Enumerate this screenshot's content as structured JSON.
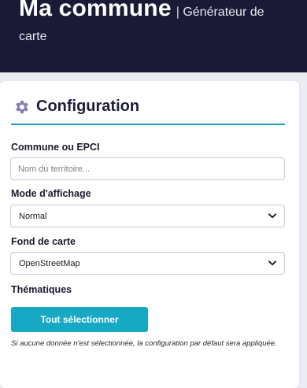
{
  "header": {
    "title": "Ma commune",
    "separator": "|",
    "subtitle_part1": "Générateur de",
    "subtitle_part2": "carte"
  },
  "panel": {
    "title": "Configuration",
    "icon": "gear-icon"
  },
  "fields": {
    "commune": {
      "label": "Commune ou EPCI",
      "value": "",
      "placeholder": "Nom du territoire..."
    },
    "mode": {
      "label": "Mode d'affichage",
      "selected": "Normal"
    },
    "fond": {
      "label": "Fond de carte",
      "selected": "OpenStreetMap"
    },
    "thematiques": {
      "label": "Thématiques"
    }
  },
  "actions": {
    "select_all_label": "Tout sélectionner"
  },
  "help": {
    "text": "Si aucune donnée n'est sélectionnée, la configuration par défaut sera appliquée."
  },
  "colors": {
    "header_bg": "#1b1a36",
    "accent": "#17a8c4",
    "gear": "#8a7fae"
  }
}
